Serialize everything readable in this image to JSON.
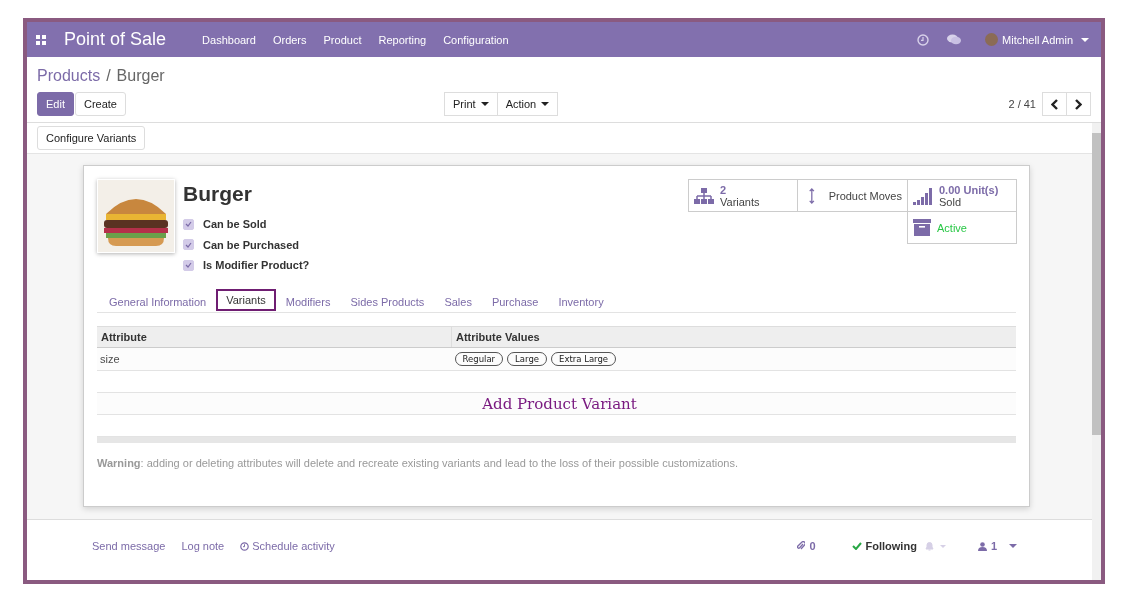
{
  "app": {
    "title": "Point of Sale",
    "menu": [
      "Dashboard",
      "Orders",
      "Product",
      "Reporting",
      "Configuration"
    ],
    "user": "Mitchell Admin"
  },
  "breadcrumb_separator": "/",
  "breadcrumb": [
    {
      "label": "Products",
      "link": true
    },
    {
      "label": "Burger",
      "link": false
    }
  ],
  "buttons": [
    {
      "label": "Edit",
      "primary": true
    },
    {
      "label": "Create",
      "primary": false
    }
  ],
  "dropdowns": [
    "Print",
    "Action"
  ],
  "pager": "2 / 41",
  "configure_button": "Configure Variants",
  "product": {
    "name": "Burger",
    "options": [
      {
        "label": "Can be Sold",
        "checked": true
      },
      {
        "label": "Can be Purchased",
        "checked": true
      },
      {
        "label": "Is Modifier Product?",
        "checked": true
      }
    ]
  },
  "smart_buttons": [
    {
      "kind": "variants",
      "value": "2",
      "label": "Variants"
    },
    {
      "kind": "moves",
      "label": "Product Moves"
    },
    {
      "kind": "sold",
      "value": "0.00 Unit(s)",
      "label": "Sold"
    },
    {
      "kind": "archive",
      "label": "Active"
    }
  ],
  "tabs": [
    {
      "label": "General Information",
      "selected": false
    },
    {
      "label": "Variants",
      "selected": true
    },
    {
      "label": "Modifiers",
      "selected": false
    },
    {
      "label": "Sides Products",
      "selected": false
    },
    {
      "label": "Sales",
      "selected": false
    },
    {
      "label": "Purchase",
      "selected": false
    },
    {
      "label": "Inventory",
      "selected": false
    }
  ],
  "table": {
    "columns": [
      "Attribute",
      "Attribute Values"
    ],
    "rows": [
      {
        "attribute": "size",
        "values": [
          "Regular",
          "Large",
          "Extra Large"
        ]
      }
    ]
  },
  "add_link": "Add Product Variant",
  "warning": "**Warning**: adding or deleting attributes will delete and recreate existing variants and lead to the loss of their possible customizations.",
  "chatter": {
    "actions": [
      "Send message",
      "Log note",
      "Schedule activity"
    ],
    "attachments": "0",
    "following": "Following",
    "followers": "1"
  }
}
